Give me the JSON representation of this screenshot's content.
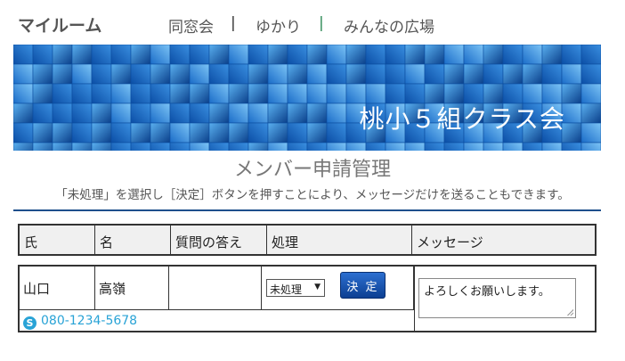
{
  "topnav": {
    "logo": "マイルーム",
    "links": [
      "同窓会",
      "ゆかり",
      "みんなの広場"
    ],
    "separator": "|"
  },
  "banner": {
    "title": "桃小５組クラス会"
  },
  "page": {
    "title": "メンバー申請管理",
    "description": "「未処理」を選択し［決定］ボタンを押すことにより、メッセージだけを送ることもできます。"
  },
  "table": {
    "headers": [
      "氏",
      "名",
      "質問の答え",
      "処理",
      "メッセージ"
    ],
    "rows": [
      {
        "last_name": "山口",
        "first_name": "高嶺",
        "answer": "",
        "status": "未処理",
        "decide_label": "決 定",
        "message": "よろしくお願いします。",
        "phone": "080-1234-5678"
      }
    ]
  },
  "colors": {
    "banner_blue": "#0d5db0",
    "divider": "#1e4f8c",
    "phone_link": "#29a3d6"
  },
  "icons": {
    "select_arrow": "▼",
    "skype": "S"
  }
}
